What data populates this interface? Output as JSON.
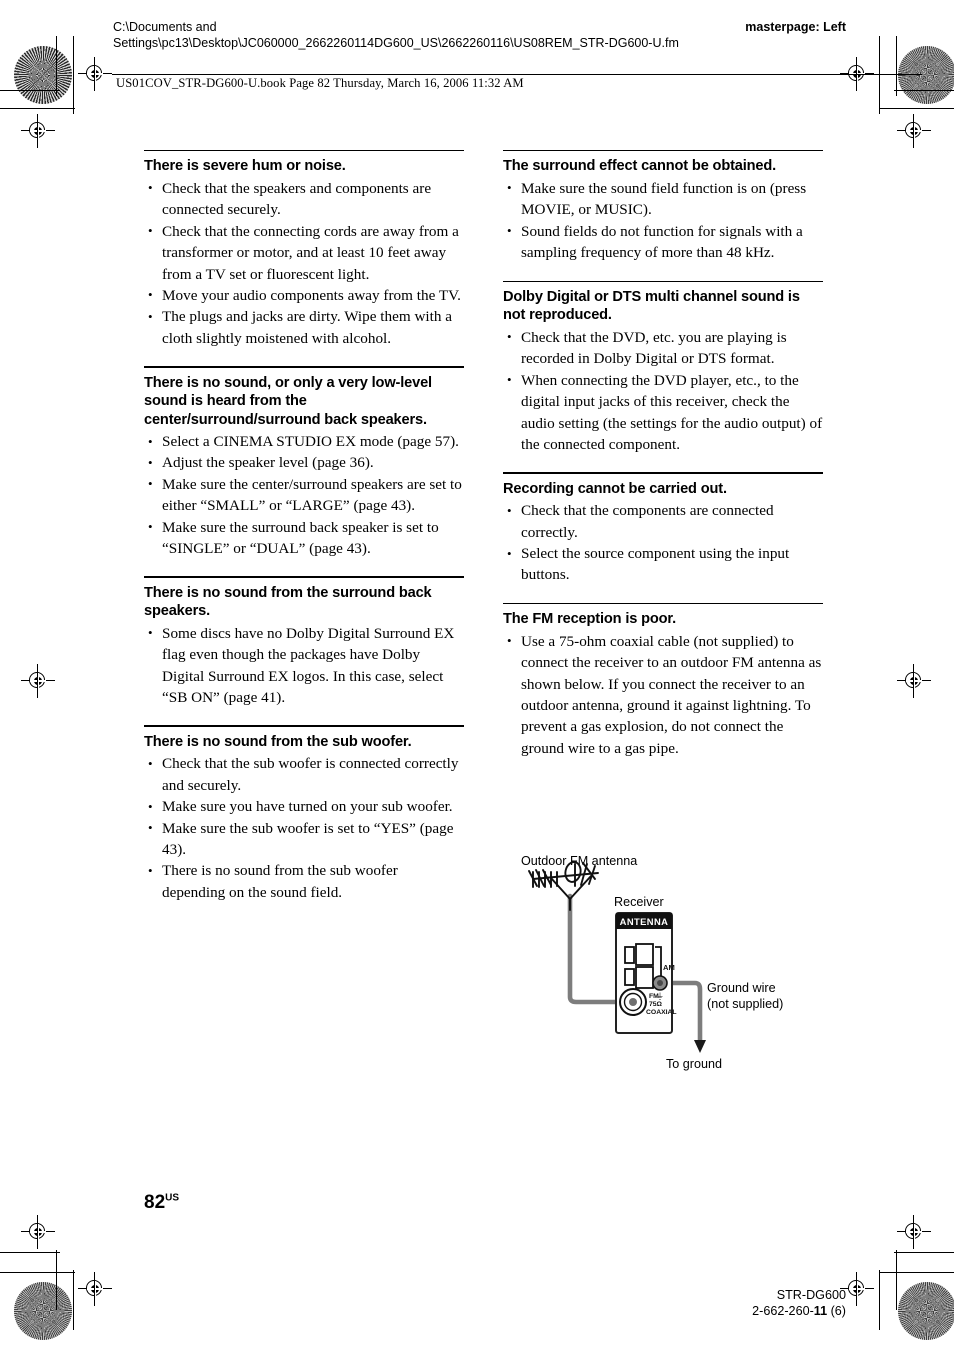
{
  "header": {
    "file_path": "C:\\Documents and Settings\\pc13\\Desktop\\JC060000_2662260114DG600_US\\2662260116\\US08REM_STR-DG600-U.fm",
    "masterpage": "masterpage: Left",
    "book_line": "US01COV_STR-DG600-U.book  Page 82  Thursday, March 16, 2006  11:32 AM"
  },
  "columns": {
    "left": [
      {
        "heading": "There is severe hum or noise.",
        "items": [
          "Check that the speakers and components are connected securely.",
          "Check that the connecting cords are away from a transformer or motor, and at least 10 feet away from a TV set or fluorescent light.",
          "Move your audio components away from the TV.",
          "The plugs and jacks are dirty. Wipe them with a cloth slightly moistened with alcohol."
        ]
      },
      {
        "heading": "There is no sound, or only a very low-level sound is heard from the center/surround/surround back speakers.",
        "items": [
          "Select a CINEMA STUDIO EX mode (page 57).",
          "Adjust the speaker level (page 36).",
          "Make sure the center/surround speakers are set to either “SMALL” or “LARGE” (page 43).",
          "Make sure the surround back speaker is set to “SINGLE” or “DUAL” (page 43)."
        ]
      },
      {
        "heading": "There is no sound from the surround back speakers.",
        "items": [
          "Some discs have no Dolby Digital Surround EX flag even though the packages have Dolby Digital Surround EX logos. In this case, select “SB ON” (page 41)."
        ]
      },
      {
        "heading": "There is no sound from the sub woofer.",
        "items": [
          "Check that the sub woofer is connected correctly and securely.",
          "Make sure you have turned on your sub woofer.",
          "Make sure the sub woofer is set to “YES” (page 43).",
          "There is no sound from the sub woofer depending on the sound field."
        ]
      }
    ],
    "right": [
      {
        "heading": "The surround effect cannot be obtained.",
        "items": [
          "Make sure the sound field function is on (press MOVIE, or MUSIC).",
          "Sound fields do not function for signals with a sampling frequency of more than 48 kHz."
        ]
      },
      {
        "heading": "Dolby Digital or DTS multi channel sound is not reproduced.",
        "items": [
          "Check that the DVD, etc. you are playing is recorded in Dolby Digital or DTS format.",
          "When connecting the DVD player, etc., to the digital input jacks of this receiver, check the audio setting (the settings for the audio output) of the connected component."
        ]
      },
      {
        "heading": "Recording cannot be carried out.",
        "items": [
          "Check that the components are connected correctly.",
          "Select the source component using the input buttons."
        ]
      },
      {
        "heading": "The FM reception is poor.",
        "items": [
          "Use a 75-ohm coaxial cable (not supplied) to connect the receiver to an outdoor FM antenna as shown below. If you connect the receiver to an outdoor antenna, ground it against lightning. To prevent a gas explosion, do not connect the ground wire to a gas pipe."
        ]
      }
    ]
  },
  "diagram": {
    "antenna_label": "Outdoor FM antenna",
    "receiver_label": "Receiver",
    "panel_title": "ANTENNA",
    "am_label": "AM",
    "fm_jack_label": "FM\n75Ω\nCOAXIAL",
    "ground_wire_label": "Ground wire\n(not supplied)",
    "to_ground_label": "To ground"
  },
  "footer": {
    "page_number": "82",
    "page_suffix": "US",
    "model": "STR-DG600",
    "doc_number_prefix": "2-662-260-",
    "doc_number_bold": "11",
    "doc_number_suffix": " (6)"
  },
  "colors": {
    "text": "#000000",
    "page_bg": "#ffffff",
    "wire": "#7d7d7d",
    "panel_stroke": "#3a3a3a"
  }
}
